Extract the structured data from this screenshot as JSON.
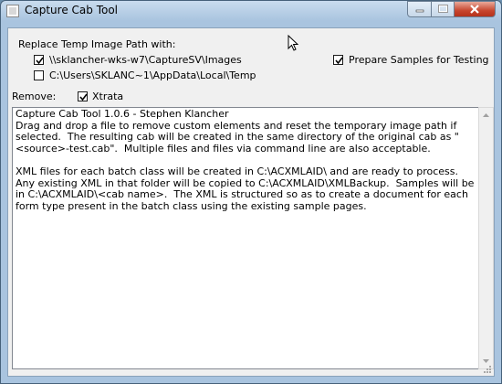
{
  "window": {
    "title": "Capture Cab Tool"
  },
  "replace_group": {
    "label": "Replace Temp Image Path with:",
    "options": [
      {
        "path": "\\\\sklancher-wks-w7\\CaptureSV\\Images",
        "checked": true
      },
      {
        "path": "C:\\Users\\SKLANC~1\\AppData\\Local\\Temp",
        "checked": false
      }
    ]
  },
  "prepare_samples": {
    "label": "Prepare Samples for Testing",
    "checked": true
  },
  "remove": {
    "label": "Remove:",
    "option_label": "Xtrata",
    "checked": true
  },
  "info_text": {
    "paragraphs": [
      "Capture Cab Tool 1.0.6 - Stephen Klancher\nDrag and drop a file to remove custom elements and reset the temporary image path if selected.  The resulting cab will be created in the same directory of the original cab as \"<source>-test.cab\".  Multiple files and files via command line are also acceptable.",
      "XML files for each batch class will be created in C:\\ACXMLAID\\ and are ready to process.  Any existing XML in that folder will be copied to C:\\ACXMLAID\\XMLBackup.  Samples will be in C:\\ACXMLAID\\<cab name>.  The XML is structured so as to create a document for each form type present in the batch class using the existing sample pages."
    ]
  }
}
